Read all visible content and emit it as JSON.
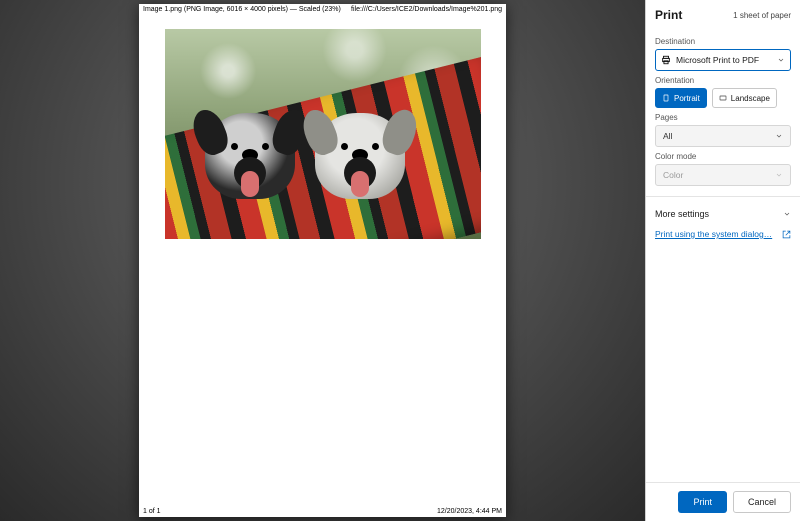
{
  "preview": {
    "header_left": "Image 1.png (PNG Image, 6016 × 4000 pixels) — Scaled (23%)",
    "header_right": "file:///C:/Users/ICE2/Downloads/Image%201.png",
    "footer_left": "1 of 1",
    "footer_right": "12/20/2023, 4:44 PM"
  },
  "panel": {
    "title": "Print",
    "sheet_count": "1 sheet of paper",
    "destination": {
      "label": "Destination",
      "value": "Microsoft Print to PDF"
    },
    "orientation": {
      "label": "Orientation",
      "portrait": "Portrait",
      "landscape": "Landscape"
    },
    "pages": {
      "label": "Pages",
      "value": "All"
    },
    "color_mode": {
      "label": "Color mode",
      "value": "Color"
    },
    "more_settings": "More settings",
    "system_dialog": "Print using the system dialog…",
    "footer": {
      "print": "Print",
      "cancel": "Cancel"
    }
  }
}
